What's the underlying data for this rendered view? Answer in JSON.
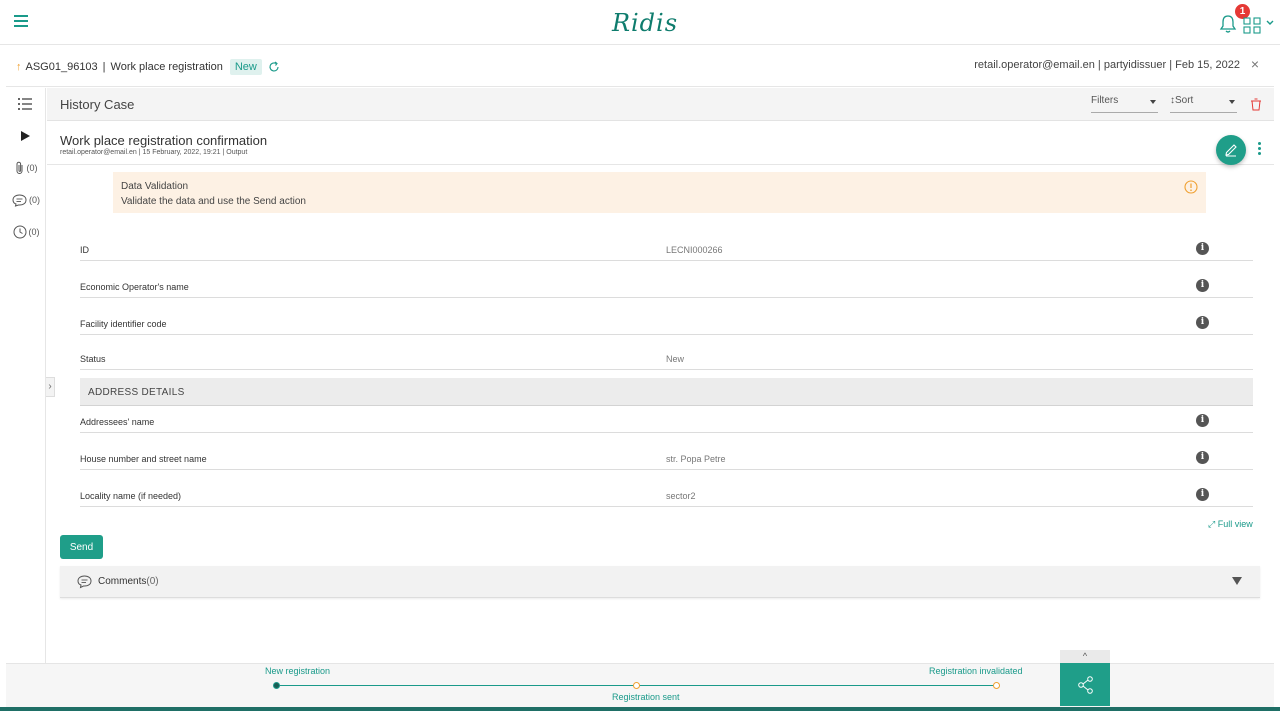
{
  "app": {
    "logo_text": "Ridis",
    "notifications_count": "1"
  },
  "case": {
    "id": "ASG01_96103",
    "separator": "|",
    "type": "Work place registration",
    "status": "New",
    "user_info": "retail.operator@email.en | partyidissuer | Feb 15, 2022"
  },
  "sidebar": {
    "attachments_count": "(0)",
    "comments_count": "(0)",
    "history_count": "(0)"
  },
  "history": {
    "title": "History Case",
    "filters_label": "Filters",
    "sort_label": "Sort"
  },
  "entry": {
    "title": "Work place registration confirmation",
    "meta": "retail.operator@email.en | 15 February, 2022, 19:21 | Output"
  },
  "alert": {
    "title": "Data Validation",
    "message": "Validate the data and use the Send action"
  },
  "fields": [
    {
      "label": "ID",
      "value": "LECNI000266"
    },
    {
      "label": "Economic Operator's name",
      "value": ""
    },
    {
      "label": "Facility identifier code",
      "value": ""
    },
    {
      "label": "Status",
      "value": "New"
    }
  ],
  "address": {
    "header": "ADDRESS DETAILS",
    "fields": [
      {
        "label": "Addressees' name",
        "value": ""
      },
      {
        "label": "House number and street name",
        "value": "str. Popa Petre"
      },
      {
        "label": "Locality name (if needed)",
        "value": "sector2"
      }
    ]
  },
  "actions": {
    "full_view": "Full view",
    "send": "Send"
  },
  "comments": {
    "label": "Comments",
    "count": "(0)"
  },
  "timeline": {
    "steps": [
      {
        "label": "New registration",
        "state": "completed"
      },
      {
        "label": "Registration sent",
        "state": "pending"
      },
      {
        "label": "Registration invalidated",
        "state": "pending"
      }
    ]
  },
  "colors": {
    "accent": "#1f9e89",
    "warning": "#f0a030",
    "alert_bg": "#fdf1e4",
    "badge": "#e53935",
    "danger": "#e53935"
  },
  "icons": [
    "menu-icon",
    "bell-icon",
    "apps-grid-icon",
    "chevron-down-icon",
    "refresh-icon",
    "close-icon",
    "list-icon",
    "play-icon",
    "paperclip-icon",
    "comment-icon",
    "clock-icon",
    "trash-icon",
    "edit-icon",
    "more-vertical-icon",
    "warning-icon",
    "info-icon",
    "share-icon",
    "chevron-up-icon",
    "chevron-right-icon",
    "expand-icon"
  ]
}
